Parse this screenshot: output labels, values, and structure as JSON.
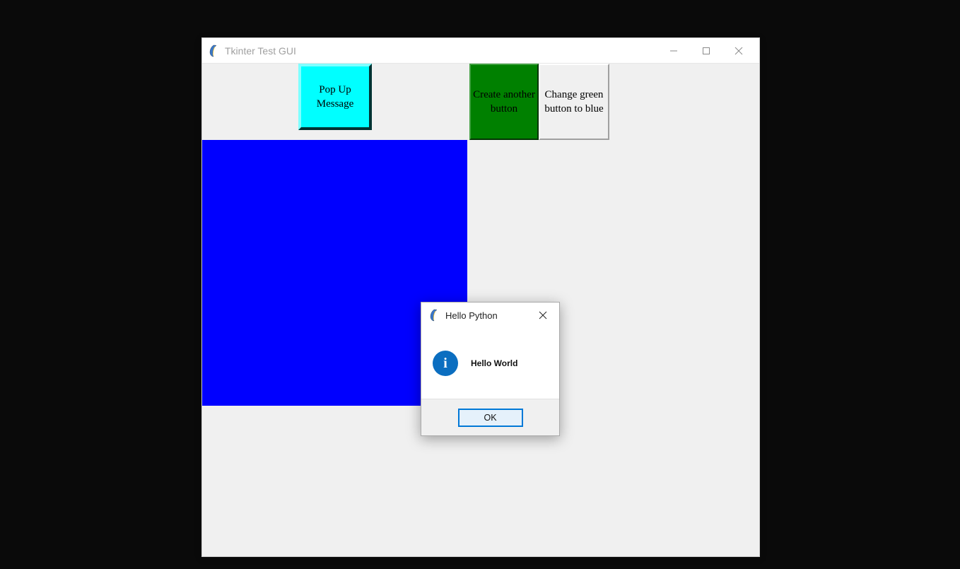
{
  "main_window": {
    "title": "Tkinter Test GUI"
  },
  "buttons": {
    "popup_label": "Pop Up Message",
    "create_label": "Create another button",
    "change_label": "Change green button to blue"
  },
  "dialog": {
    "title": "Hello Python",
    "message": "Hello World",
    "ok_label": "OK",
    "info_glyph": "i"
  },
  "colors": {
    "popup_bg": "#00ffff",
    "green_bg": "#008000",
    "canvas_bg": "#0000ff",
    "ok_border": "#0078d7",
    "info_icon_bg": "#0b6ec0"
  }
}
